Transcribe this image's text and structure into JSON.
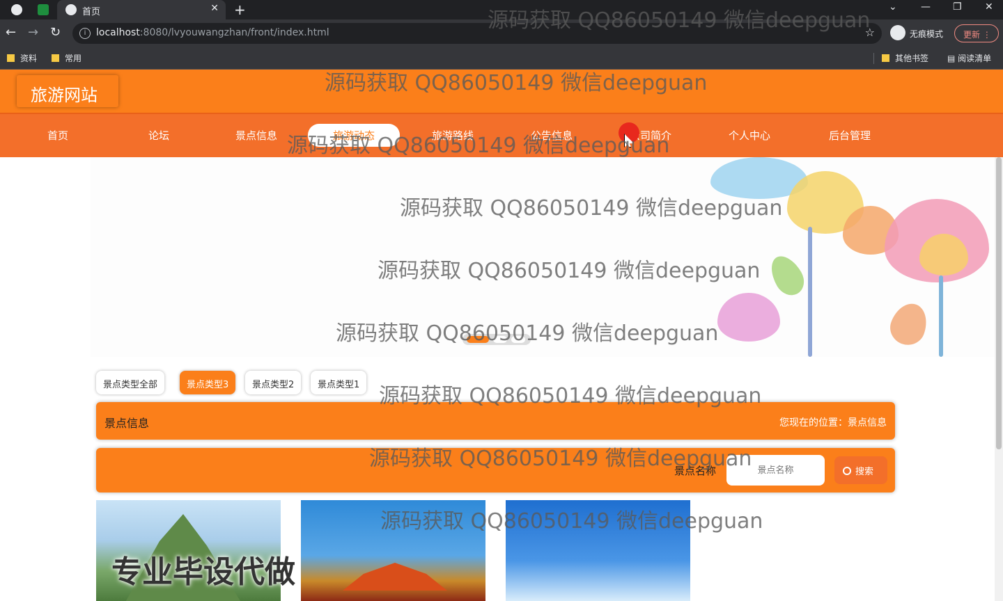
{
  "browser": {
    "tab_title": "首页",
    "url_host": "localhost",
    "url_rest": ":8080/lvyouwangzhan/front/index.html",
    "incognito_label": "无痕模式",
    "update_label": "更新",
    "bookmarks": [
      "资料",
      "常用",
      "其他书签",
      "阅读清单"
    ]
  },
  "site": {
    "logo": "旅游网站",
    "nav": [
      "首页",
      "论坛",
      "景点信息",
      "旅游动态",
      "旅游路线",
      "公告信息",
      "公司简介",
      "个人中心",
      "后台管理"
    ],
    "active_nav": "旅游动态"
  },
  "types": [
    "景点类型全部",
    "景点类型3",
    "景点类型2",
    "景点类型1"
  ],
  "active_type": "景点类型3",
  "section": {
    "title": "景点信息",
    "location": "您现在的位置：景点信息"
  },
  "search": {
    "label": "景点名称",
    "placeholder": "景点名称",
    "button": "搜索"
  },
  "watermark": "源码获取 QQ86050149 微信deepguan",
  "overlay_text": "专业毕设代做",
  "colors": {
    "brand": "#fb7f1a",
    "nav": "#f36f2a"
  }
}
